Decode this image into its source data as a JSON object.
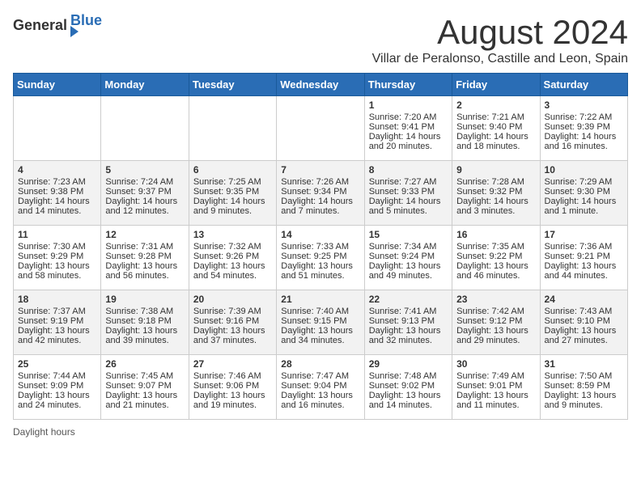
{
  "header": {
    "logo_general": "General",
    "logo_blue": "Blue",
    "month_title": "August 2024",
    "location": "Villar de Peralonso, Castille and Leon, Spain"
  },
  "days_of_week": [
    "Sunday",
    "Monday",
    "Tuesday",
    "Wednesday",
    "Thursday",
    "Friday",
    "Saturday"
  ],
  "weeks": [
    [
      {
        "day": "",
        "info": ""
      },
      {
        "day": "",
        "info": ""
      },
      {
        "day": "",
        "info": ""
      },
      {
        "day": "",
        "info": ""
      },
      {
        "day": "1",
        "info": "Sunrise: 7:20 AM\nSunset: 9:41 PM\nDaylight: 14 hours and 20 minutes."
      },
      {
        "day": "2",
        "info": "Sunrise: 7:21 AM\nSunset: 9:40 PM\nDaylight: 14 hours and 18 minutes."
      },
      {
        "day": "3",
        "info": "Sunrise: 7:22 AM\nSunset: 9:39 PM\nDaylight: 14 hours and 16 minutes."
      }
    ],
    [
      {
        "day": "4",
        "info": "Sunrise: 7:23 AM\nSunset: 9:38 PM\nDaylight: 14 hours and 14 minutes."
      },
      {
        "day": "5",
        "info": "Sunrise: 7:24 AM\nSunset: 9:37 PM\nDaylight: 14 hours and 12 minutes."
      },
      {
        "day": "6",
        "info": "Sunrise: 7:25 AM\nSunset: 9:35 PM\nDaylight: 14 hours and 9 minutes."
      },
      {
        "day": "7",
        "info": "Sunrise: 7:26 AM\nSunset: 9:34 PM\nDaylight: 14 hours and 7 minutes."
      },
      {
        "day": "8",
        "info": "Sunrise: 7:27 AM\nSunset: 9:33 PM\nDaylight: 14 hours and 5 minutes."
      },
      {
        "day": "9",
        "info": "Sunrise: 7:28 AM\nSunset: 9:32 PM\nDaylight: 14 hours and 3 minutes."
      },
      {
        "day": "10",
        "info": "Sunrise: 7:29 AM\nSunset: 9:30 PM\nDaylight: 14 hours and 1 minute."
      }
    ],
    [
      {
        "day": "11",
        "info": "Sunrise: 7:30 AM\nSunset: 9:29 PM\nDaylight: 13 hours and 58 minutes."
      },
      {
        "day": "12",
        "info": "Sunrise: 7:31 AM\nSunset: 9:28 PM\nDaylight: 13 hours and 56 minutes."
      },
      {
        "day": "13",
        "info": "Sunrise: 7:32 AM\nSunset: 9:26 PM\nDaylight: 13 hours and 54 minutes."
      },
      {
        "day": "14",
        "info": "Sunrise: 7:33 AM\nSunset: 9:25 PM\nDaylight: 13 hours and 51 minutes."
      },
      {
        "day": "15",
        "info": "Sunrise: 7:34 AM\nSunset: 9:24 PM\nDaylight: 13 hours and 49 minutes."
      },
      {
        "day": "16",
        "info": "Sunrise: 7:35 AM\nSunset: 9:22 PM\nDaylight: 13 hours and 46 minutes."
      },
      {
        "day": "17",
        "info": "Sunrise: 7:36 AM\nSunset: 9:21 PM\nDaylight: 13 hours and 44 minutes."
      }
    ],
    [
      {
        "day": "18",
        "info": "Sunrise: 7:37 AM\nSunset: 9:19 PM\nDaylight: 13 hours and 42 minutes."
      },
      {
        "day": "19",
        "info": "Sunrise: 7:38 AM\nSunset: 9:18 PM\nDaylight: 13 hours and 39 minutes."
      },
      {
        "day": "20",
        "info": "Sunrise: 7:39 AM\nSunset: 9:16 PM\nDaylight: 13 hours and 37 minutes."
      },
      {
        "day": "21",
        "info": "Sunrise: 7:40 AM\nSunset: 9:15 PM\nDaylight: 13 hours and 34 minutes."
      },
      {
        "day": "22",
        "info": "Sunrise: 7:41 AM\nSunset: 9:13 PM\nDaylight: 13 hours and 32 minutes."
      },
      {
        "day": "23",
        "info": "Sunrise: 7:42 AM\nSunset: 9:12 PM\nDaylight: 13 hours and 29 minutes."
      },
      {
        "day": "24",
        "info": "Sunrise: 7:43 AM\nSunset: 9:10 PM\nDaylight: 13 hours and 27 minutes."
      }
    ],
    [
      {
        "day": "25",
        "info": "Sunrise: 7:44 AM\nSunset: 9:09 PM\nDaylight: 13 hours and 24 minutes."
      },
      {
        "day": "26",
        "info": "Sunrise: 7:45 AM\nSunset: 9:07 PM\nDaylight: 13 hours and 21 minutes."
      },
      {
        "day": "27",
        "info": "Sunrise: 7:46 AM\nSunset: 9:06 PM\nDaylight: 13 hours and 19 minutes."
      },
      {
        "day": "28",
        "info": "Sunrise: 7:47 AM\nSunset: 9:04 PM\nDaylight: 13 hours and 16 minutes."
      },
      {
        "day": "29",
        "info": "Sunrise: 7:48 AM\nSunset: 9:02 PM\nDaylight: 13 hours and 14 minutes."
      },
      {
        "day": "30",
        "info": "Sunrise: 7:49 AM\nSunset: 9:01 PM\nDaylight: 13 hours and 11 minutes."
      },
      {
        "day": "31",
        "info": "Sunrise: 7:50 AM\nSunset: 8:59 PM\nDaylight: 13 hours and 9 minutes."
      }
    ]
  ],
  "footer": {
    "daylight_label": "Daylight hours"
  }
}
